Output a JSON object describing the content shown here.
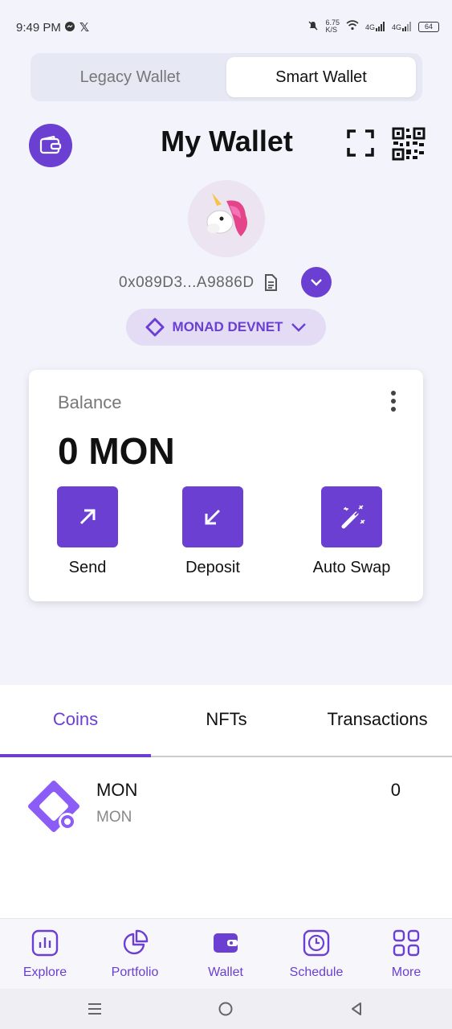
{
  "status_bar": {
    "time": "9:49 PM",
    "speed": "6.75",
    "speed_unit": "K/S",
    "net_a": "4G",
    "net_b": "4G",
    "battery": "64"
  },
  "wallet_toggle": {
    "options": [
      "Legacy Wallet",
      "Smart Wallet"
    ],
    "selected": "Smart Wallet"
  },
  "header": {
    "title": "My Wallet"
  },
  "account": {
    "address": "0x089D3...A9886D"
  },
  "network": {
    "name": "MONAD DEVNET"
  },
  "balance": {
    "label": "Balance",
    "value": "0 MON",
    "actions": [
      {
        "label": "Send",
        "icon": "arrow-up-right-icon"
      },
      {
        "label": "Deposit",
        "icon": "arrow-down-left-icon"
      },
      {
        "label": "Auto Swap",
        "icon": "magic-wand-icon"
      }
    ]
  },
  "tabs": {
    "items": [
      "Coins",
      "NFTs",
      "Transactions"
    ],
    "active": "Coins"
  },
  "coins": [
    {
      "name": "MON",
      "symbol": "MON",
      "amount": "0"
    }
  ],
  "bottom_nav": {
    "items": [
      {
        "label": "Explore",
        "icon": "bar-chart-icon"
      },
      {
        "label": "Portfolio",
        "icon": "pie-chart-icon"
      },
      {
        "label": "Wallet",
        "icon": "wallet-icon"
      },
      {
        "label": "Schedule",
        "icon": "clock-icon"
      },
      {
        "label": "More",
        "icon": "grid-icon"
      }
    ],
    "active": "Wallet"
  },
  "colors": {
    "accent": "#6b3fd1",
    "background": "#f3f3fb",
    "pill": "#e3dcf4"
  }
}
